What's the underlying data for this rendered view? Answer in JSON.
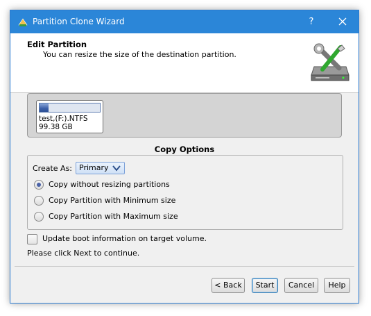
{
  "window": {
    "title": "Partition Clone Wizard",
    "help_glyph": "?",
    "accent": "#2b86d8"
  },
  "header": {
    "title": "Edit Partition",
    "subtitle": "You can resize the size of the destination partition.",
    "icon": "disk-wrench-icon"
  },
  "disk_map": {
    "partition": {
      "name": "test,(F:).NTFS",
      "size": "99.38 GB",
      "usage_fraction": 0.15
    }
  },
  "copy_options": {
    "title": "Copy Options",
    "create_as_label": "Create As:",
    "create_as_value": "Primary",
    "radios": [
      {
        "label": "Copy without resizing partitions",
        "checked": true
      },
      {
        "label": "Copy Partition with Minimum size",
        "checked": false
      },
      {
        "label": "Copy Partition with Maximum size",
        "checked": false
      }
    ]
  },
  "boot_checkbox": {
    "label": "Update boot information on target volume.",
    "checked": false
  },
  "instruction": "Please click Next to continue.",
  "buttons": {
    "back": "< Back",
    "start": "Start",
    "cancel": "Cancel",
    "help": "Help"
  }
}
